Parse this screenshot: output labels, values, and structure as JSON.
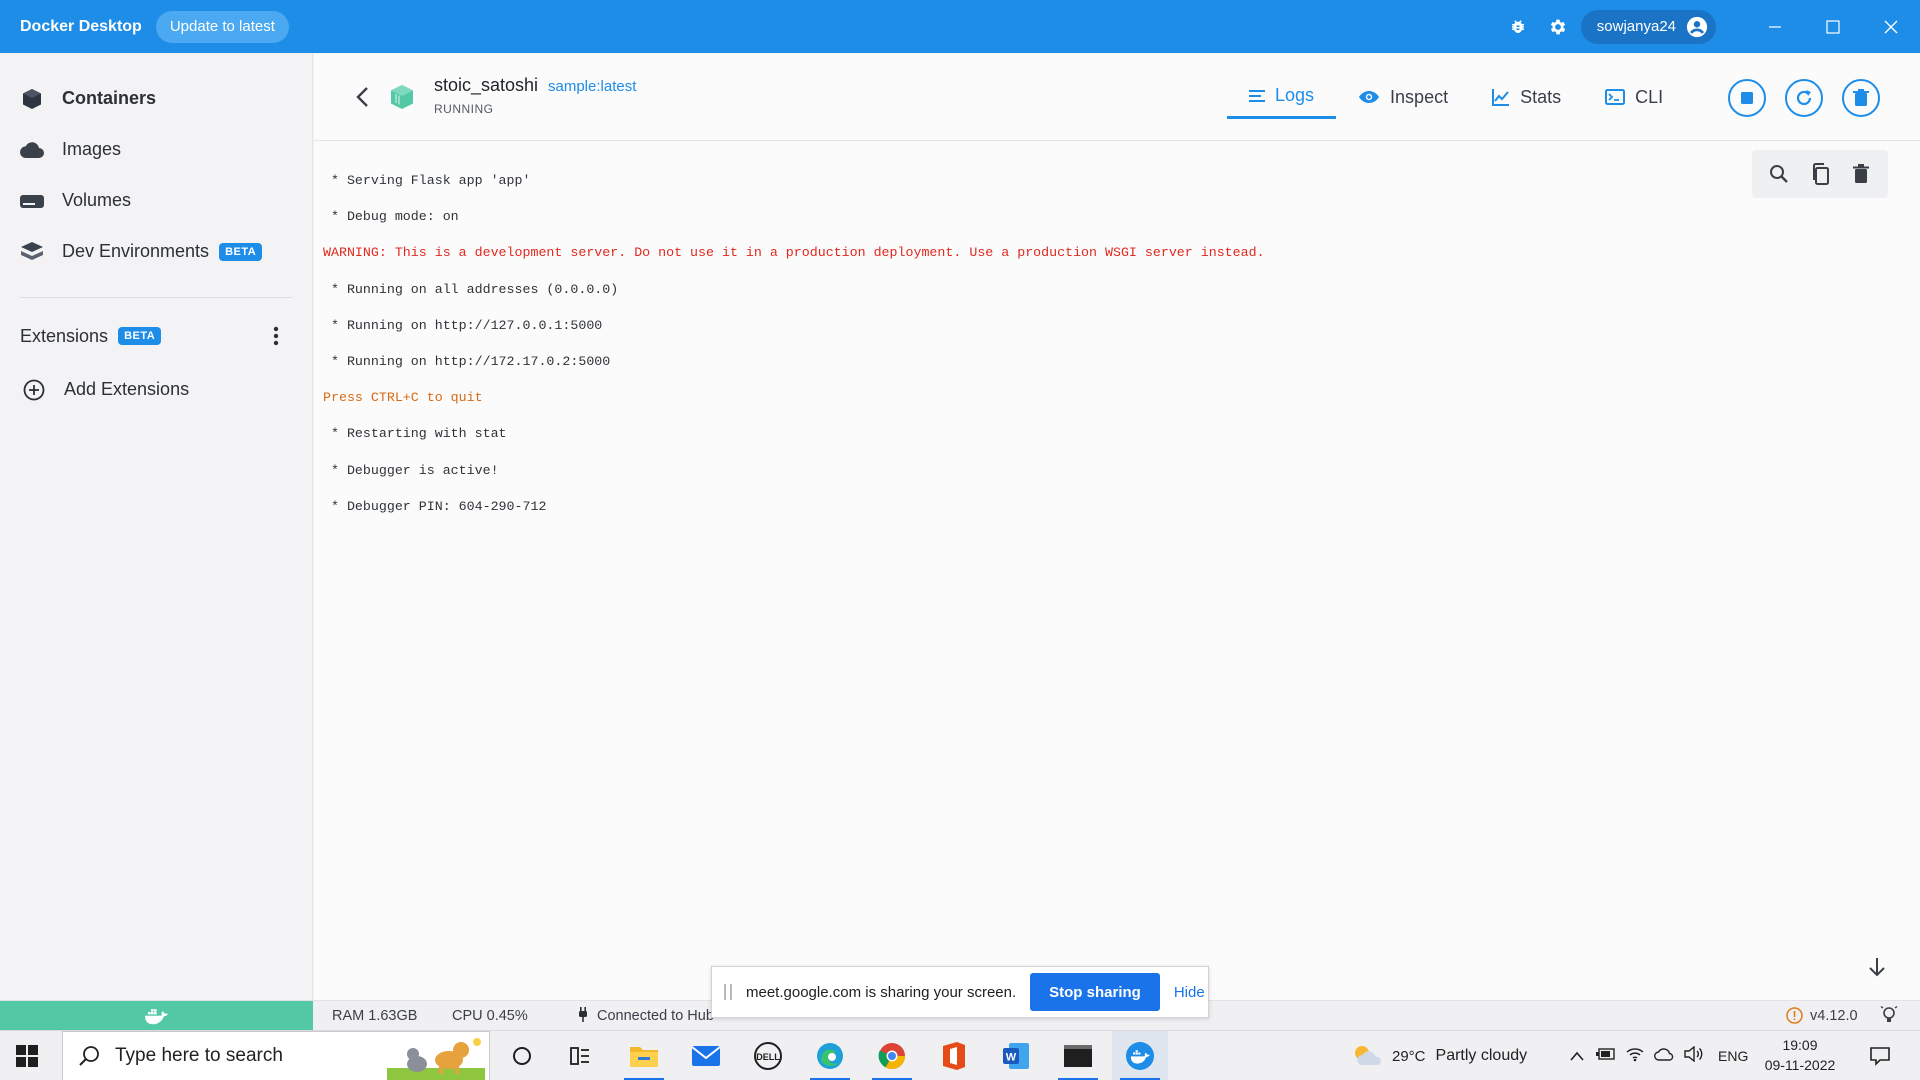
{
  "titlebar": {
    "app_name": "Docker Desktop",
    "update_label": "Update to latest",
    "username": "sowjanya24",
    "accent": "#1d8de8"
  },
  "sidebar": {
    "items": [
      {
        "label": "Containers",
        "icon": "containers-icon",
        "active": true
      },
      {
        "label": "Images",
        "icon": "cloud-icon"
      },
      {
        "label": "Volumes",
        "icon": "volume-icon"
      },
      {
        "label": "Dev Environments",
        "icon": "dev-env-icon",
        "badge": "BETA"
      }
    ],
    "extensions_label": "Extensions",
    "extensions_badge": "BETA",
    "add_extensions_label": "Add Extensions"
  },
  "container": {
    "name": "stoic_satoshi",
    "image": "sample:latest",
    "status": "RUNNING"
  },
  "tabs": [
    {
      "label": "Logs",
      "icon": "logs-icon",
      "active": true
    },
    {
      "label": "Inspect",
      "icon": "eye-icon"
    },
    {
      "label": "Stats",
      "icon": "chart-icon"
    },
    {
      "label": "CLI",
      "icon": "terminal-icon"
    }
  ],
  "logs": [
    {
      "text": " * Serving Flask app 'app'",
      "level": "info"
    },
    {
      "text": " * Debug mode: on",
      "level": "info"
    },
    {
      "text": "WARNING: This is a development server. Do not use it in a production deployment. Use a production WSGI server instead.",
      "level": "warning"
    },
    {
      "text": " * Running on all addresses (0.0.0.0)",
      "level": "info"
    },
    {
      "text": " * Running on http://127.0.0.1:5000",
      "level": "info"
    },
    {
      "text": " * Running on http://172.17.0.2:5000",
      "level": "info"
    },
    {
      "text": "Press CTRL+C to quit",
      "level": "quit"
    },
    {
      "text": " * Restarting with stat",
      "level": "info"
    },
    {
      "text": " * Debugger is active!",
      "level": "info"
    },
    {
      "text": " * Debugger PIN: 604-290-712",
      "level": "info"
    }
  ],
  "statusbar": {
    "ram": "RAM 1.63GB",
    "cpu": "CPU 0.45%",
    "hub": "Connected to Hub",
    "version": "v4.12.0"
  },
  "share_bar": {
    "text": "meet.google.com is sharing your screen.",
    "stop_label": "Stop sharing",
    "hide_label": "Hide"
  },
  "taskbar": {
    "search_placeholder": "Type here to search",
    "weather_temp": "29°C",
    "weather_desc": "Partly cloudy",
    "lang": "ENG",
    "time": "19:09",
    "date": "09-11-2022"
  }
}
